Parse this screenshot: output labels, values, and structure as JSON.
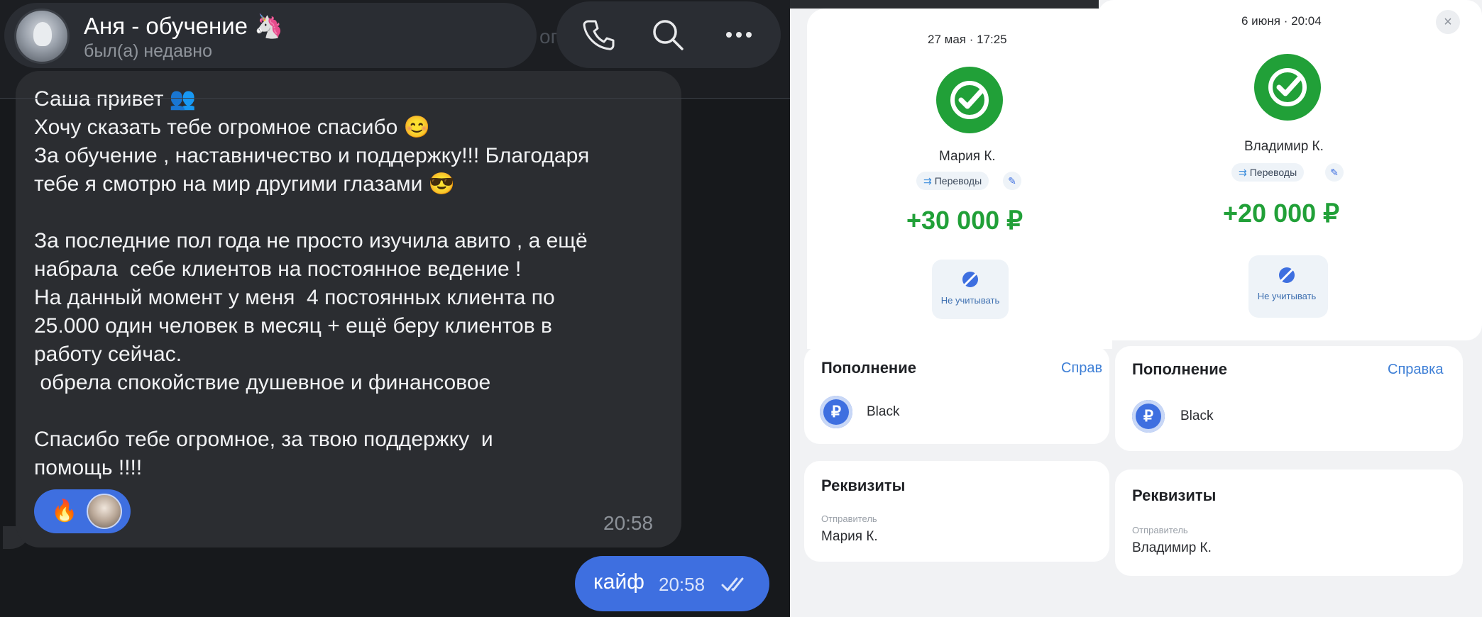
{
  "chat": {
    "contact_name": "Аня - обучение 🦄",
    "contact_status": "был(а) недавно",
    "header_fragment": "ог",
    "message": {
      "lines": [
        "Саша привет 👥",
        "Хочу сказать тебе огромное спасибо 😊",
        "За обучение , наставничество и поддержку!!! Благодаря",
        "тебе я смотрю на мир другими глазами 😎",
        "",
        "За последние пол года не просто изучила авито , а ещё",
        "набрала  себе клиентов на постоянное ведение !",
        "На данный момент у меня  4 постоянных клиента по",
        "25.000 один человек в месяц + ещё беру клиентов в",
        "работу сейчас.",
        " обрела спокойствие душевное и финансовое",
        "",
        "Спасибо тебе огромное, за твою поддержку  и",
        "помощь !!!!"
      ],
      "reaction_emoji": "🔥",
      "time": "20:58"
    },
    "outgoing": {
      "text": "кайф",
      "time": "20:58"
    }
  },
  "receipts": [
    {
      "datetime": "27 мая · 17:25",
      "name": "Мария К.",
      "category": "Переводы",
      "amount": "+30 000 ₽",
      "ignore_label": "Не учитывать",
      "section_title": "Пополнение",
      "help_link": "Справ",
      "card_name": "Black",
      "details_title": "Реквизиты",
      "sender_label": "Отправитель",
      "sender": "Мария К."
    },
    {
      "datetime": "6 июня · 20:04",
      "name": "Владимир К.",
      "category": "Переводы",
      "amount": "+20 000 ₽",
      "ignore_label": "Не учитывать",
      "section_title": "Пополнение",
      "help_link": "Справка",
      "card_name": "Black",
      "details_title": "Реквизиты",
      "sender_label": "Отправитель",
      "sender": "Владимир К."
    }
  ],
  "colors": {
    "chat_bg": "#17191c",
    "bubble": "#2b2d31",
    "accent_blue": "#3e6fe0",
    "bank_green": "#21a038"
  },
  "icons": [
    "phone-icon",
    "search-icon",
    "more-icon",
    "double-check-icon",
    "sber-logo-icon",
    "transfer-icon",
    "pencil-icon",
    "ignore-icon",
    "ruble-card-icon",
    "close-icon"
  ]
}
